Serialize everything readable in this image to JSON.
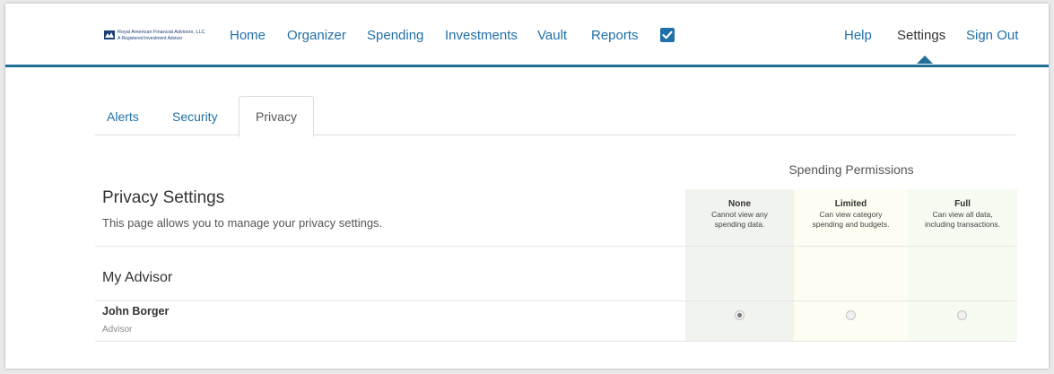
{
  "brand": {
    "name": "Royal American Financial Advisors, LLC",
    "tagline": "A Registered Investment Advisor"
  },
  "nav": {
    "home": "Home",
    "organizer": "Organizer",
    "spending": "Spending",
    "investments": "Investments",
    "vault": "Vault",
    "reports": "Reports",
    "help": "Help",
    "settings": "Settings",
    "sign_out": "Sign Out"
  },
  "tabs": {
    "alerts": "Alerts",
    "security": "Security",
    "privacy": "Privacy",
    "active": "Privacy"
  },
  "page": {
    "title": "Privacy Settings",
    "description": "This page allows you to manage your privacy settings."
  },
  "permissions": {
    "heading": "Spending Permissions",
    "columns": [
      {
        "title": "None",
        "line1": "Cannot view any",
        "line2": "spending data."
      },
      {
        "title": "Limited",
        "line1": "Can view category",
        "line2": "spending and budgets."
      },
      {
        "title": "Full",
        "line1": "Can view all data,",
        "line2": "including transactions."
      }
    ]
  },
  "advisor_section": {
    "title": "My Advisor",
    "people": [
      {
        "name": "John Borger",
        "role": "Advisor",
        "permission": "None"
      }
    ]
  },
  "colors": {
    "accent": "#1f6f97",
    "link": "#1f6fa8"
  }
}
